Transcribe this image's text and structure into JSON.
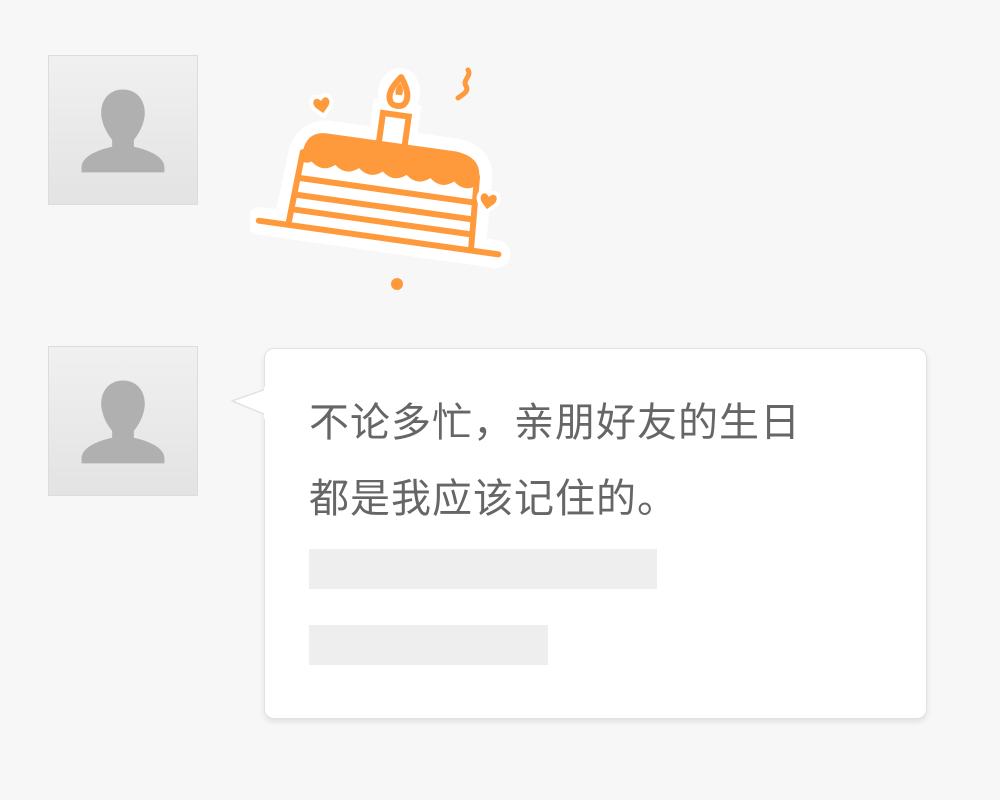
{
  "messages": [
    {
      "type": "sticker",
      "avatar_icon": "user-silhouette-icon",
      "sticker_icon": "birthday-cake-icon",
      "sticker_color": "#ff9a3c"
    },
    {
      "type": "text",
      "avatar_icon": "user-silhouette-icon",
      "text_lines": [
        "不论多忙，亲朋好友的生日",
        "都是我应该记住的。"
      ],
      "placeholder_lines": 2
    }
  ],
  "colors": {
    "background": "#f7f7f7",
    "bubble": "#ffffff",
    "text": "#666666",
    "placeholder": "#eeeeee",
    "avatar_silhouette": "#b0b0b0",
    "accent": "#ff9a3c"
  }
}
